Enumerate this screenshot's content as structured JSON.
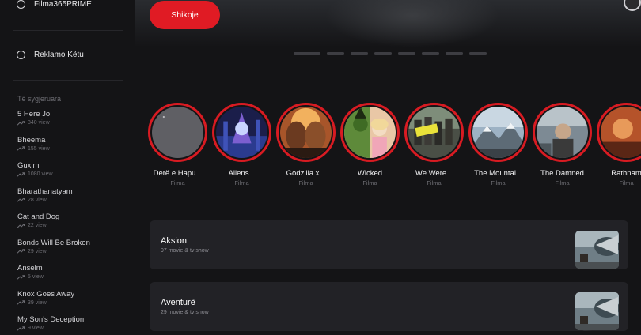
{
  "sidebar": {
    "top_link": "Filma365PRIME",
    "ad_link": "Reklamo Këtu",
    "trending_heading": "Të sygjeruara",
    "trending": [
      {
        "title": "5 Here Jo",
        "views": "340 view"
      },
      {
        "title": "Bheema",
        "views": "155 view"
      },
      {
        "title": "Guxim",
        "views": "1080 view"
      },
      {
        "title": "Bharathanatyam",
        "views": "28 view"
      },
      {
        "title": "Cat and Dog",
        "views": "22 view"
      },
      {
        "title": "Bonds Will Be Broken",
        "views": "29 view"
      },
      {
        "title": "Anselm",
        "views": "5 view"
      },
      {
        "title": "Knox Goes Away",
        "views": "39 view"
      },
      {
        "title": "My Son's Deception",
        "views": "9 view"
      }
    ]
  },
  "hero": {
    "watch_label": "Shikoje",
    "slide_count": 8,
    "active_slide": 1
  },
  "stories": [
    {
      "title": "Derë e Hapu...",
      "subtitle": "Filma"
    },
    {
      "title": "Aliens...",
      "subtitle": "Filma"
    },
    {
      "title": "Godzilla x...",
      "subtitle": "Filma"
    },
    {
      "title": "Wicked",
      "subtitle": "Filma"
    },
    {
      "title": "We Were...",
      "subtitle": "Filma"
    },
    {
      "title": "The Mountai...",
      "subtitle": "Filma"
    },
    {
      "title": "The Damned",
      "subtitle": "Filma"
    },
    {
      "title": "Rathnam",
      "subtitle": "Filma"
    }
  ],
  "genres": [
    {
      "name": "Aksion",
      "count": "97 movie & tv show"
    },
    {
      "name": "Aventurë",
      "count": "29 movie & tv show"
    }
  ],
  "colors": {
    "accent": "#e01b24",
    "ring": "#d81b22",
    "background": "#141416",
    "card": "#222226"
  }
}
